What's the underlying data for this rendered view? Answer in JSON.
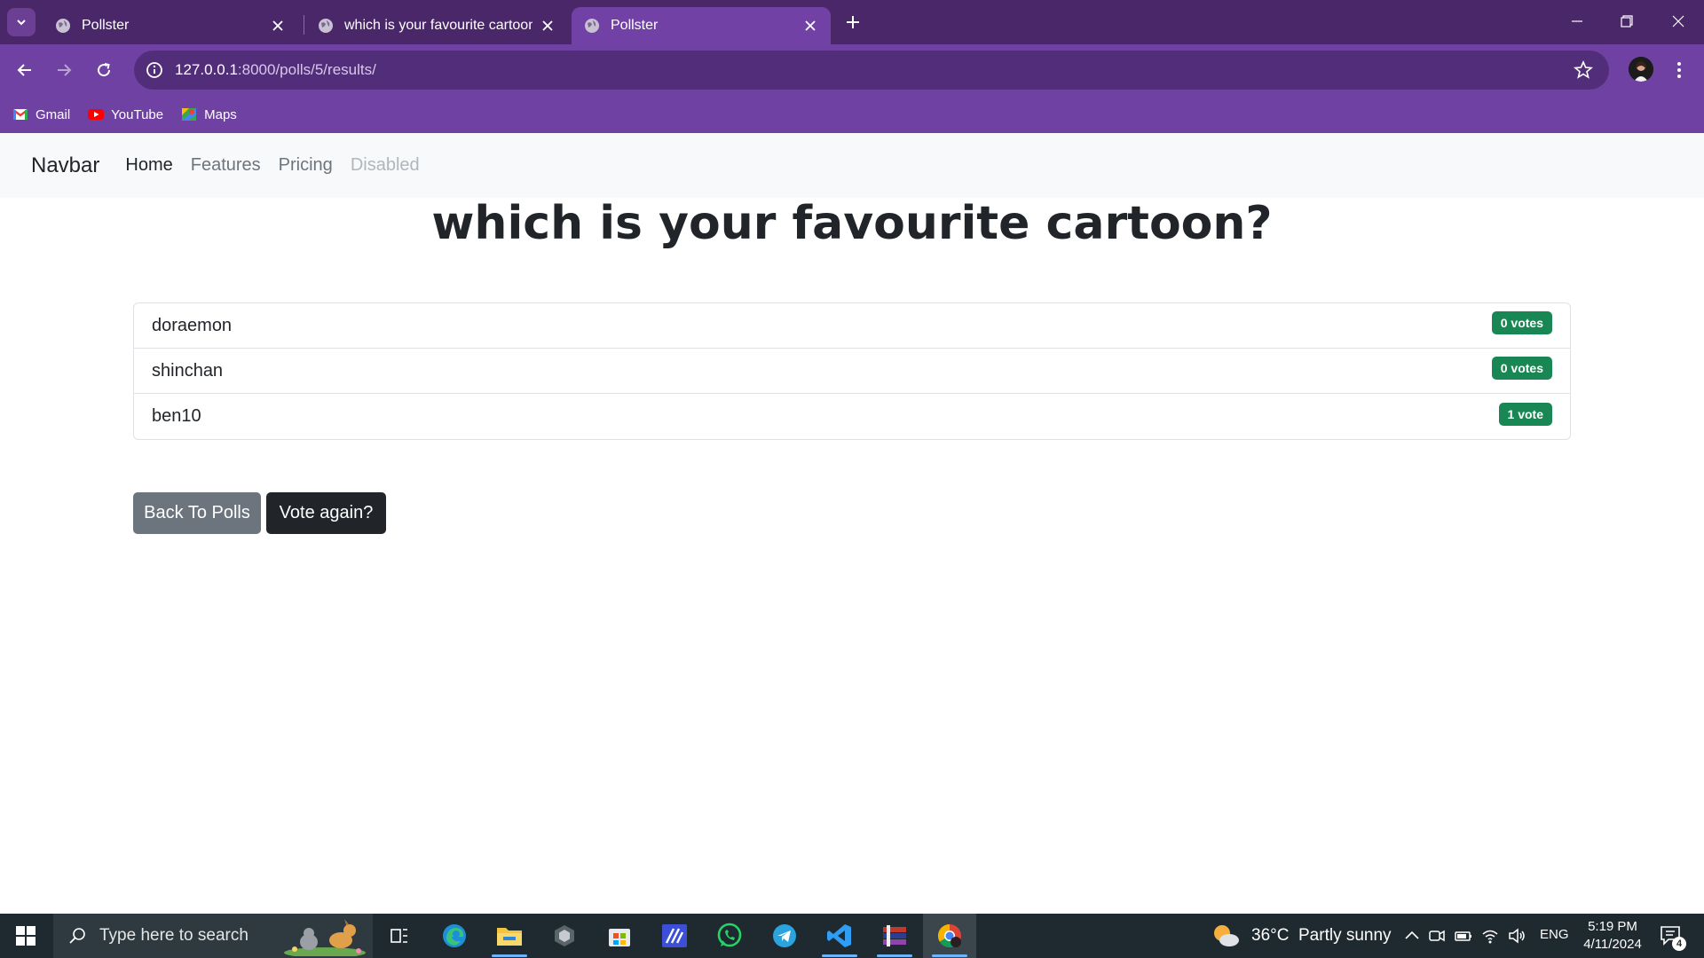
{
  "browser": {
    "tabs": [
      {
        "title": "Pollster",
        "active": false
      },
      {
        "title": "which is your favourite cartoon?",
        "active": false
      },
      {
        "title": "Pollster",
        "active": true
      }
    ],
    "url_host": "127.0.0.1",
    "url_path": ":8000/polls/5/results/",
    "bookmarks": [
      {
        "label": "Gmail",
        "icon": "gmail-icon"
      },
      {
        "label": "YouTube",
        "icon": "youtube-icon"
      },
      {
        "label": "Maps",
        "icon": "maps-icon"
      }
    ]
  },
  "navbar": {
    "brand": "Navbar",
    "links": [
      {
        "label": "Home",
        "state": "active"
      },
      {
        "label": "Features",
        "state": "normal"
      },
      {
        "label": "Pricing",
        "state": "normal"
      },
      {
        "label": "Disabled",
        "state": "disabled"
      }
    ]
  },
  "poll": {
    "question": "which is your favourite cartoon?",
    "choices": [
      {
        "label": "doraemon",
        "votes": "0 votes"
      },
      {
        "label": "shinchan",
        "votes": "0 votes"
      },
      {
        "label": "ben10",
        "votes": "1 vote"
      }
    ]
  },
  "actions": {
    "back_label": "Back To Polls",
    "vote_again_label": "Vote again?"
  },
  "taskbar": {
    "search_placeholder": "Type here to search",
    "weather": "36°C  Partly sunny",
    "language": "ENG",
    "time": "5:19 PM",
    "date": "4/11/2024",
    "notification_count": "4"
  },
  "colors": {
    "tabstrip": "#4a2768",
    "toolbar": "#6f41a2",
    "badge": "#198754",
    "btn_secondary": "#6c757d",
    "btn_dark": "#212529"
  }
}
